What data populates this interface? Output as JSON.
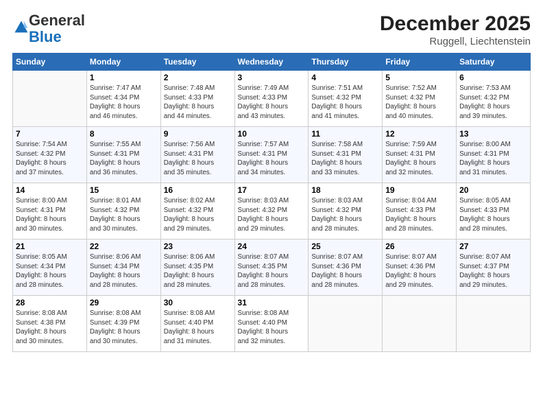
{
  "header": {
    "logo_general": "General",
    "logo_blue": "Blue",
    "month": "December 2025",
    "location": "Ruggell, Liechtenstein"
  },
  "weekdays": [
    "Sunday",
    "Monday",
    "Tuesday",
    "Wednesday",
    "Thursday",
    "Friday",
    "Saturday"
  ],
  "weeks": [
    [
      {
        "num": "",
        "info": ""
      },
      {
        "num": "1",
        "info": "Sunrise: 7:47 AM\nSunset: 4:34 PM\nDaylight: 8 hours\nand 46 minutes."
      },
      {
        "num": "2",
        "info": "Sunrise: 7:48 AM\nSunset: 4:33 PM\nDaylight: 8 hours\nand 44 minutes."
      },
      {
        "num": "3",
        "info": "Sunrise: 7:49 AM\nSunset: 4:33 PM\nDaylight: 8 hours\nand 43 minutes."
      },
      {
        "num": "4",
        "info": "Sunrise: 7:51 AM\nSunset: 4:32 PM\nDaylight: 8 hours\nand 41 minutes."
      },
      {
        "num": "5",
        "info": "Sunrise: 7:52 AM\nSunset: 4:32 PM\nDaylight: 8 hours\nand 40 minutes."
      },
      {
        "num": "6",
        "info": "Sunrise: 7:53 AM\nSunset: 4:32 PM\nDaylight: 8 hours\nand 39 minutes."
      }
    ],
    [
      {
        "num": "7",
        "info": "Sunrise: 7:54 AM\nSunset: 4:32 PM\nDaylight: 8 hours\nand 37 minutes."
      },
      {
        "num": "8",
        "info": "Sunrise: 7:55 AM\nSunset: 4:31 PM\nDaylight: 8 hours\nand 36 minutes."
      },
      {
        "num": "9",
        "info": "Sunrise: 7:56 AM\nSunset: 4:31 PM\nDaylight: 8 hours\nand 35 minutes."
      },
      {
        "num": "10",
        "info": "Sunrise: 7:57 AM\nSunset: 4:31 PM\nDaylight: 8 hours\nand 34 minutes."
      },
      {
        "num": "11",
        "info": "Sunrise: 7:58 AM\nSunset: 4:31 PM\nDaylight: 8 hours\nand 33 minutes."
      },
      {
        "num": "12",
        "info": "Sunrise: 7:59 AM\nSunset: 4:31 PM\nDaylight: 8 hours\nand 32 minutes."
      },
      {
        "num": "13",
        "info": "Sunrise: 8:00 AM\nSunset: 4:31 PM\nDaylight: 8 hours\nand 31 minutes."
      }
    ],
    [
      {
        "num": "14",
        "info": "Sunrise: 8:00 AM\nSunset: 4:31 PM\nDaylight: 8 hours\nand 30 minutes."
      },
      {
        "num": "15",
        "info": "Sunrise: 8:01 AM\nSunset: 4:32 PM\nDaylight: 8 hours\nand 30 minutes."
      },
      {
        "num": "16",
        "info": "Sunrise: 8:02 AM\nSunset: 4:32 PM\nDaylight: 8 hours\nand 29 minutes."
      },
      {
        "num": "17",
        "info": "Sunrise: 8:03 AM\nSunset: 4:32 PM\nDaylight: 8 hours\nand 29 minutes."
      },
      {
        "num": "18",
        "info": "Sunrise: 8:03 AM\nSunset: 4:32 PM\nDaylight: 8 hours\nand 28 minutes."
      },
      {
        "num": "19",
        "info": "Sunrise: 8:04 AM\nSunset: 4:33 PM\nDaylight: 8 hours\nand 28 minutes."
      },
      {
        "num": "20",
        "info": "Sunrise: 8:05 AM\nSunset: 4:33 PM\nDaylight: 8 hours\nand 28 minutes."
      }
    ],
    [
      {
        "num": "21",
        "info": "Sunrise: 8:05 AM\nSunset: 4:34 PM\nDaylight: 8 hours\nand 28 minutes."
      },
      {
        "num": "22",
        "info": "Sunrise: 8:06 AM\nSunset: 4:34 PM\nDaylight: 8 hours\nand 28 minutes."
      },
      {
        "num": "23",
        "info": "Sunrise: 8:06 AM\nSunset: 4:35 PM\nDaylight: 8 hours\nand 28 minutes."
      },
      {
        "num": "24",
        "info": "Sunrise: 8:07 AM\nSunset: 4:35 PM\nDaylight: 8 hours\nand 28 minutes."
      },
      {
        "num": "25",
        "info": "Sunrise: 8:07 AM\nSunset: 4:36 PM\nDaylight: 8 hours\nand 28 minutes."
      },
      {
        "num": "26",
        "info": "Sunrise: 8:07 AM\nSunset: 4:36 PM\nDaylight: 8 hours\nand 29 minutes."
      },
      {
        "num": "27",
        "info": "Sunrise: 8:07 AM\nSunset: 4:37 PM\nDaylight: 8 hours\nand 29 minutes."
      }
    ],
    [
      {
        "num": "28",
        "info": "Sunrise: 8:08 AM\nSunset: 4:38 PM\nDaylight: 8 hours\nand 30 minutes."
      },
      {
        "num": "29",
        "info": "Sunrise: 8:08 AM\nSunset: 4:39 PM\nDaylight: 8 hours\nand 30 minutes."
      },
      {
        "num": "30",
        "info": "Sunrise: 8:08 AM\nSunset: 4:40 PM\nDaylight: 8 hours\nand 31 minutes."
      },
      {
        "num": "31",
        "info": "Sunrise: 8:08 AM\nSunset: 4:40 PM\nDaylight: 8 hours\nand 32 minutes."
      },
      {
        "num": "",
        "info": ""
      },
      {
        "num": "",
        "info": ""
      },
      {
        "num": "",
        "info": ""
      }
    ]
  ]
}
